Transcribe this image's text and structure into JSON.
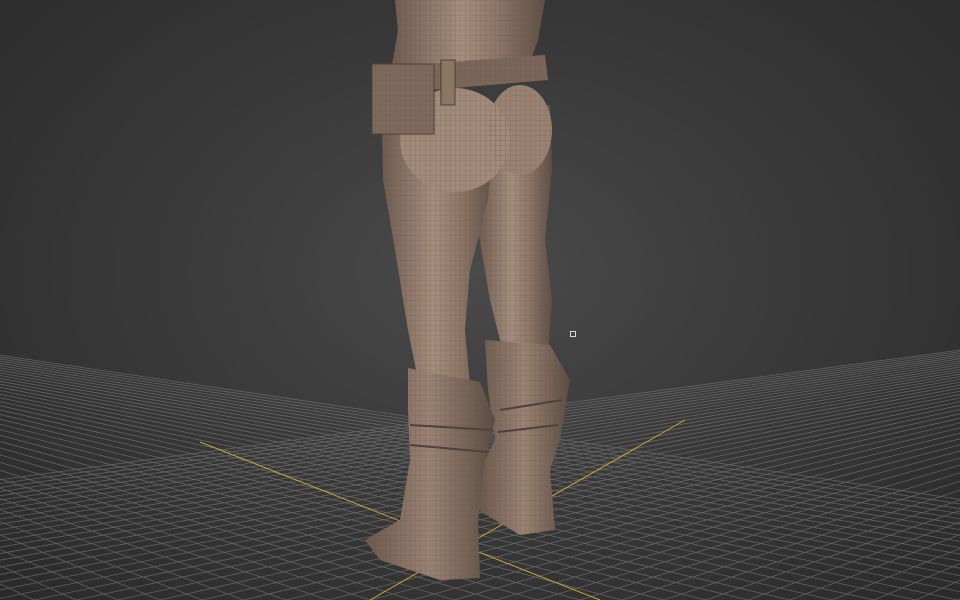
{
  "viewport": {
    "background_color": "#3a3a3a",
    "grid_color": "#8a8a8a",
    "axis_color": "#c9a23a",
    "model_color": "#8a7466",
    "wire_color": "#5b4c42"
  },
  "scene": {
    "object": "character-legs-with-boots-and-belt",
    "view": "perspective"
  },
  "icons": [
    "pivot-marker-icon"
  ]
}
